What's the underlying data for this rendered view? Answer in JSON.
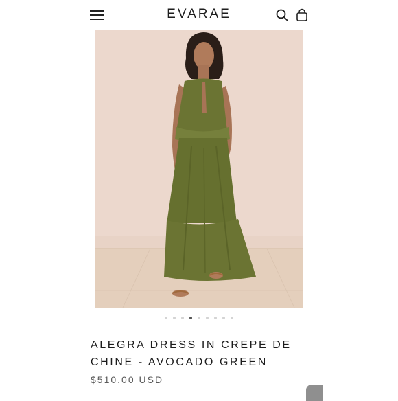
{
  "header": {
    "menu_icon": "hamburger-menu-icon",
    "brand": "EVARAE",
    "search_icon": "search-icon",
    "cart_icon": "shopping-bag-icon"
  },
  "gallery": {
    "image_alt": "Model wearing the Alegra dress in avocado green",
    "slide_count": 9,
    "active_slide": 4
  },
  "product": {
    "title": "ALEGRA DRESS IN CREPE DE CHINE - AVOCADO GREEN",
    "price": "$510.00 USD"
  },
  "colors": {
    "dress_green": "#6b7433",
    "backdrop": "#ecd7cc",
    "floor": "#e3cdb8"
  }
}
